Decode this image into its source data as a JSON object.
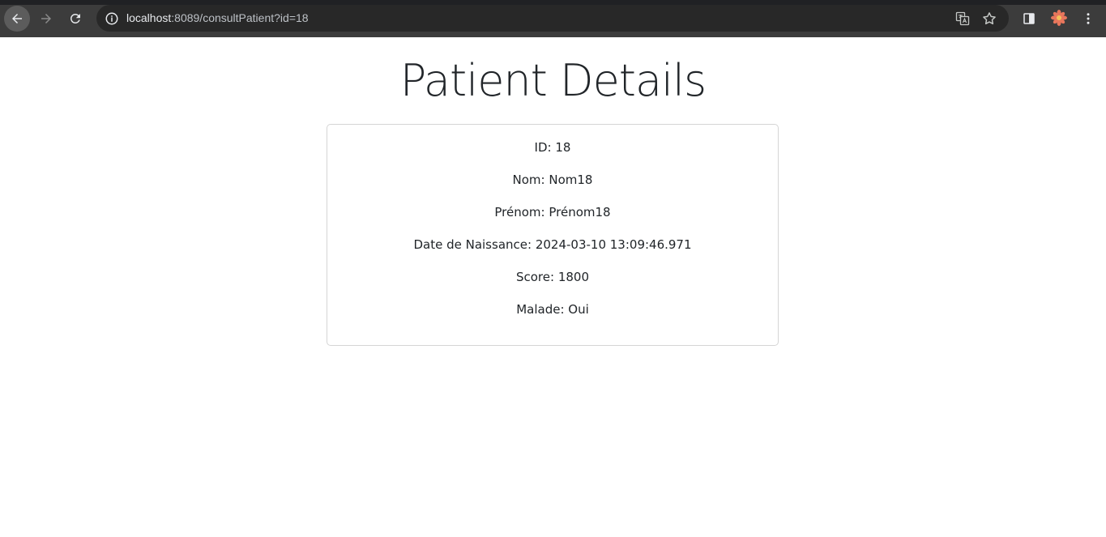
{
  "browser": {
    "url_host": "localhost",
    "url_path": ":8089/consultPatient?id=18",
    "icons": {
      "back": "arrow-left-icon",
      "forward": "arrow-right-icon",
      "reload": "reload-icon",
      "site_info": "info-circle-icon",
      "translate": "translate-icon",
      "bookmark": "star-icon",
      "side_panel": "side-panel-icon",
      "profile": "avatar",
      "menu": "vertical-dots-icon"
    }
  },
  "page": {
    "title": "Patient Details",
    "fields": {
      "id": "ID: 18",
      "nom": "Nom: Nom18",
      "prenom": "Prénom: Prénom18",
      "date_naissance": "Date de Naissance: 2024-03-10 13:09:46.971",
      "score": "Score: 1800",
      "malade": "Malade: Oui"
    }
  },
  "colors": {
    "chrome_bg": "#3c3c3c",
    "omnibox_bg": "#282828",
    "text": "#212529",
    "card_border": "#d5d5d5"
  }
}
